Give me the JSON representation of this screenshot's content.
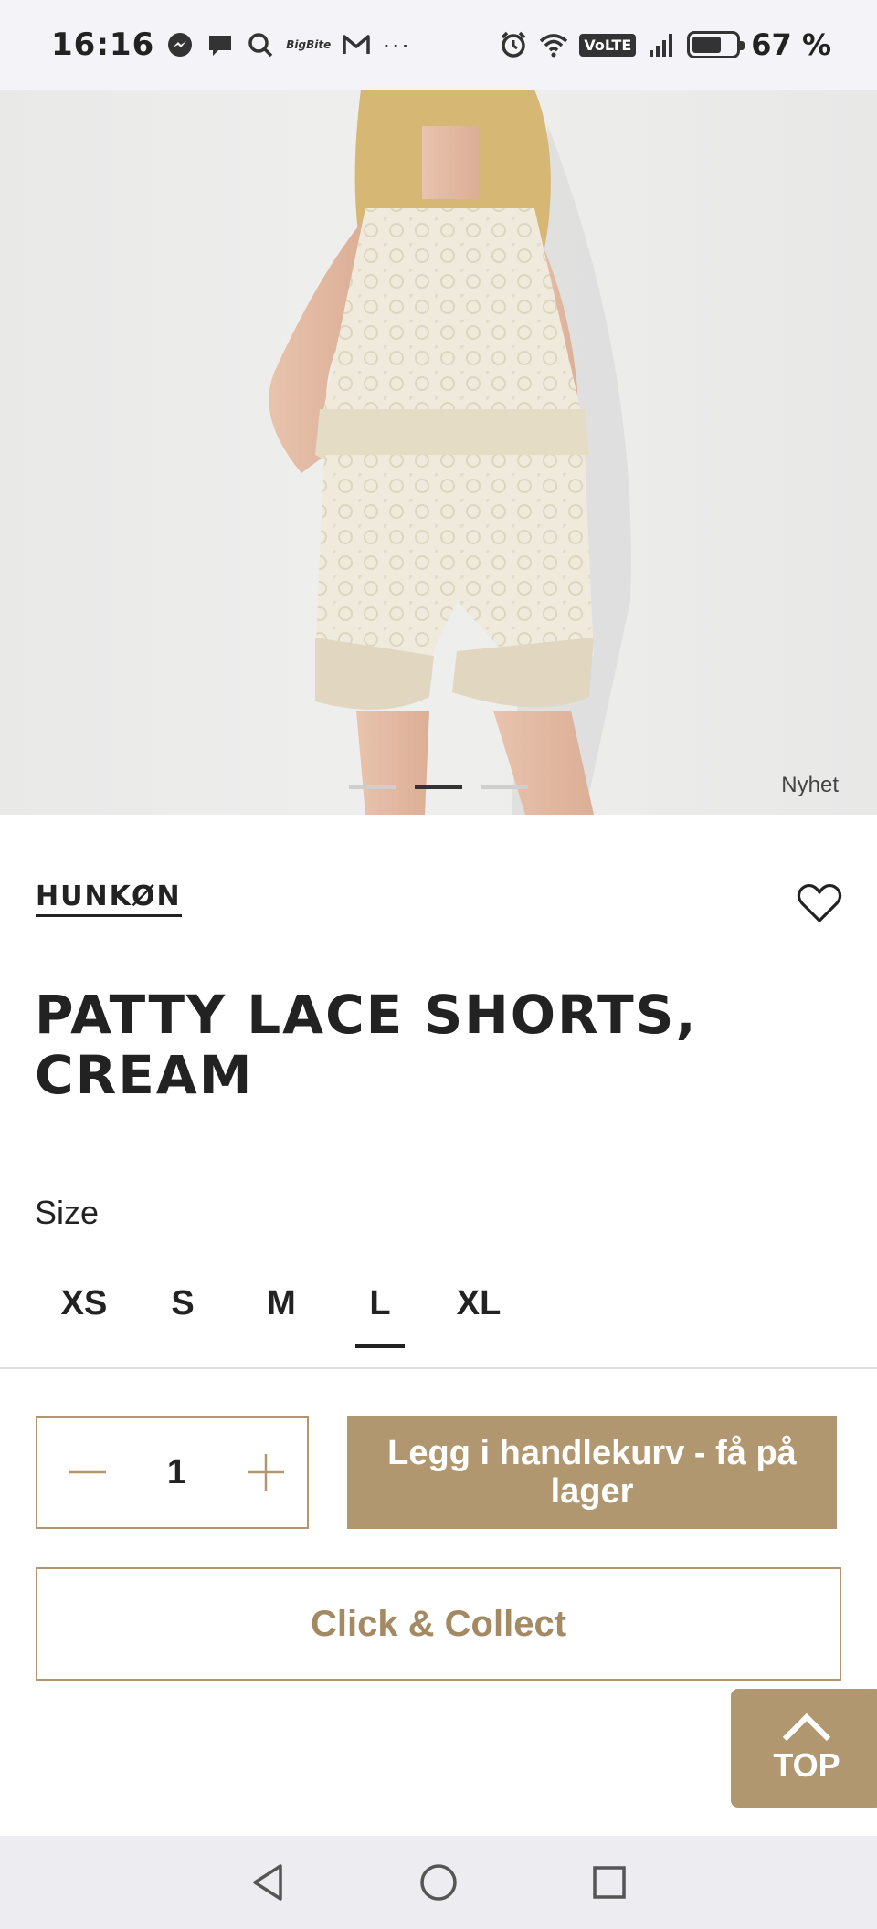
{
  "status_bar": {
    "time": "16:16",
    "notification_icons": [
      "messenger-icon",
      "chat-bubble-icon",
      "search-icon",
      "bigbite-icon",
      "gmail-icon"
    ],
    "bigbite_text": "BigBite",
    "more_indicator": "···",
    "volte_label": "VoLTE",
    "battery_percent": "67 %",
    "battery_level": 0.67
  },
  "product_image": {
    "badge": "Nyhet",
    "carousel": {
      "count": 3,
      "active_index": 1
    }
  },
  "product": {
    "brand": "HUNKØN",
    "title": "PATTY LACE SHORTS, CREAM",
    "size_label": "Size",
    "sizes": [
      "XS",
      "S",
      "M",
      "L",
      "XL"
    ],
    "selected_size": "L"
  },
  "cart": {
    "quantity": "1",
    "add_to_cart_label": "Legg i handlekurv - få på lager",
    "click_collect_label": "Click & Collect"
  },
  "scroll_top_label": "TOP",
  "colors": {
    "accent": "#b0976f",
    "text": "#222222",
    "status_bar_bg": "#f4f4f8",
    "nav_bar_bg": "#ececf1"
  }
}
